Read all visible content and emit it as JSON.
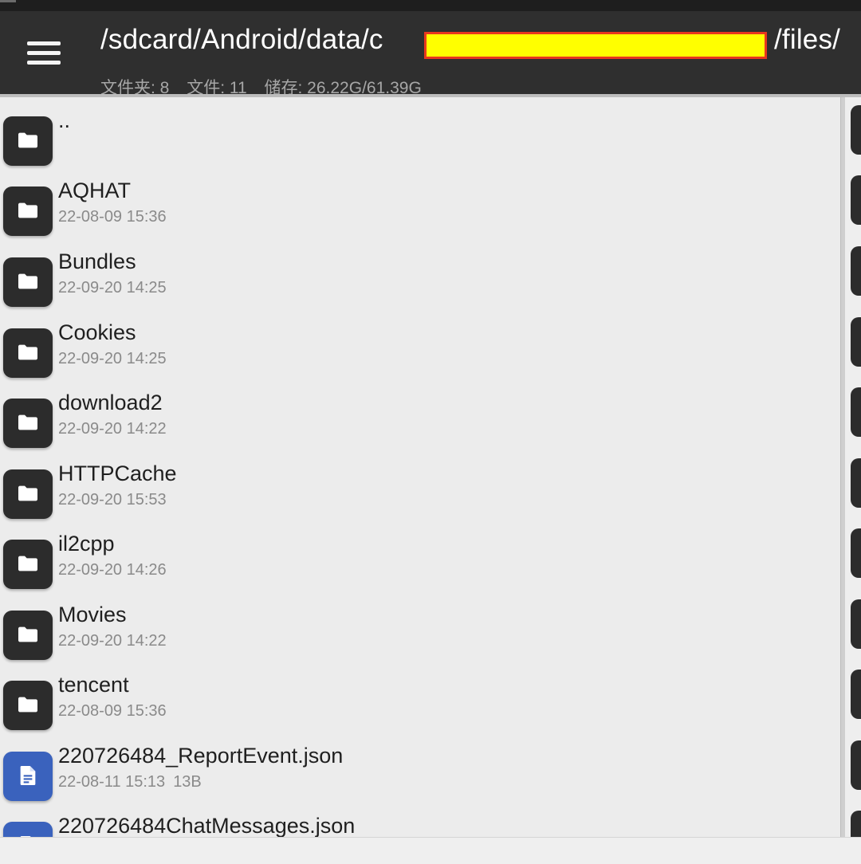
{
  "header": {
    "path_prefix": "/sdcard/Android/data/c",
    "path_suffix": "/files/",
    "stats": {
      "folders": "文件夹: 8",
      "files": "文件: 11",
      "storage": "储存: 26.22G/61.39G"
    }
  },
  "items": [
    {
      "name": "..",
      "date": "",
      "size": "",
      "kind": "folder"
    },
    {
      "name": "AQHAT",
      "date": "22-08-09 15:36",
      "size": "",
      "kind": "folder"
    },
    {
      "name": "Bundles",
      "date": "22-09-20 14:25",
      "size": "",
      "kind": "folder"
    },
    {
      "name": "Cookies",
      "date": "22-09-20 14:25",
      "size": "",
      "kind": "folder"
    },
    {
      "name": "download2",
      "date": "22-09-20 14:22",
      "size": "",
      "kind": "folder"
    },
    {
      "name": "HTTPCache",
      "date": "22-09-20 15:53",
      "size": "",
      "kind": "folder"
    },
    {
      "name": "il2cpp",
      "date": "22-09-20 14:26",
      "size": "",
      "kind": "folder"
    },
    {
      "name": "Movies",
      "date": "22-09-20 14:22",
      "size": "",
      "kind": "folder"
    },
    {
      "name": "tencent",
      "date": "22-08-09 15:36",
      "size": "",
      "kind": "folder"
    },
    {
      "name": "220726484_ReportEvent.json",
      "date": "22-08-11 15:13",
      "size": "13B",
      "kind": "file"
    },
    {
      "name": "220726484ChatMessages.json",
      "date": "",
      "size": "",
      "kind": "file"
    }
  ],
  "icons": {
    "menu": "hamburger-menu-icon",
    "folder": "folder-icon",
    "file": "document-icon"
  },
  "colors": {
    "toolbar": "#2f2f2f",
    "folder_icon_bg": "#2c2c2c",
    "file_icon_bg": "#3a62bd",
    "redaction_fill": "#ffff00",
    "redaction_border": "#e8381e"
  }
}
